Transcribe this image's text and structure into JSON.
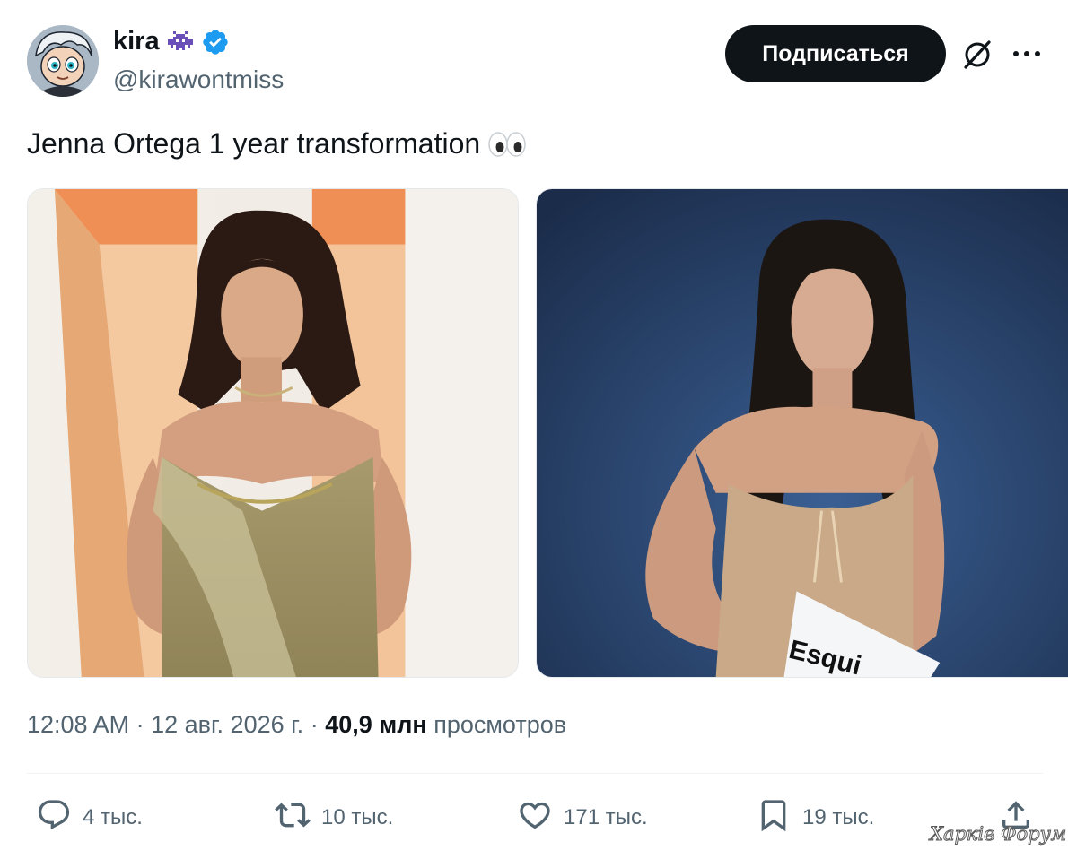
{
  "author": {
    "name": "kira",
    "handle": "@kirawontmiss",
    "verified": true,
    "name_emoji": "alien-monster-icon"
  },
  "header": {
    "follow_label": "Подписаться",
    "grok_icon": "grok-icon",
    "more_icon": "more-icon"
  },
  "tweet": {
    "text": "Jenna Ortega 1 year transformation",
    "trailing_emoji": "eyes-icon"
  },
  "media": {
    "count": 2,
    "right_image_text": "Esqui"
  },
  "meta": {
    "time": "12:08 AM",
    "date": "12 авг. 2026 г.",
    "separator": "·",
    "views_count": "40,9 млн",
    "views_label": "просмотров"
  },
  "actions": {
    "replies": "4 тыс.",
    "retweets": "10 тыс.",
    "likes": "171 тыс.",
    "bookmarks": "19 тыс."
  },
  "watermark": "Харків Форум",
  "colors": {
    "text_primary": "#0f1419",
    "text_secondary": "#536471",
    "verified_blue": "#1d9bf0",
    "button_bg": "#0f1419"
  }
}
